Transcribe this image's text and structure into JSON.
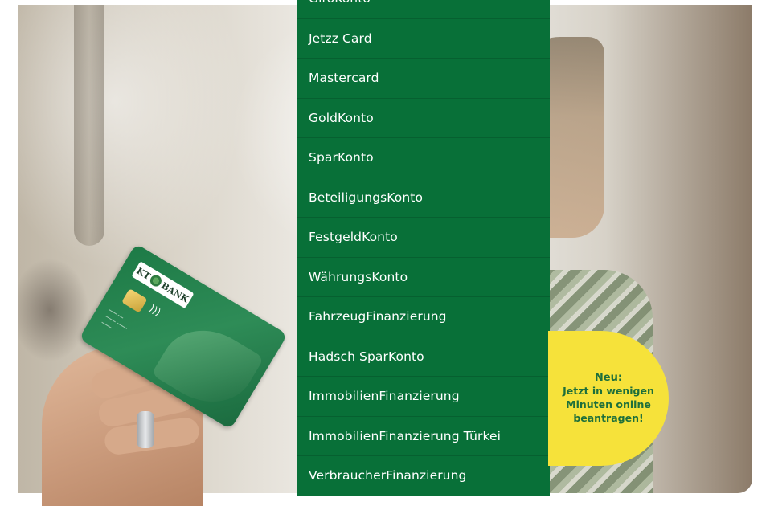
{
  "menu": {
    "items": [
      "GiroKonto",
      "Jetzz Card",
      "Mastercard",
      "GoldKonto",
      "SparKonto",
      "BeteiligungsKonto",
      "FestgeldKonto",
      "WährungsKonto",
      "FahrzeugFinanzierung",
      "Hadsch SparKonto",
      "ImmobilienFinanzierung",
      "ImmobilienFinanzierung Türkei",
      "VerbraucherFinanzierung"
    ]
  },
  "card": {
    "logo_left": "KT",
    "logo_right": "BANK"
  },
  "badge": {
    "title": "Neu:",
    "line1": "Jetzt in wenigen",
    "line2": "Minuten online",
    "line3": "beantragen!"
  },
  "colors": {
    "menu_bg": "#087038",
    "badge_bg": "#f6e23a",
    "badge_text": "#1d6f3b"
  }
}
